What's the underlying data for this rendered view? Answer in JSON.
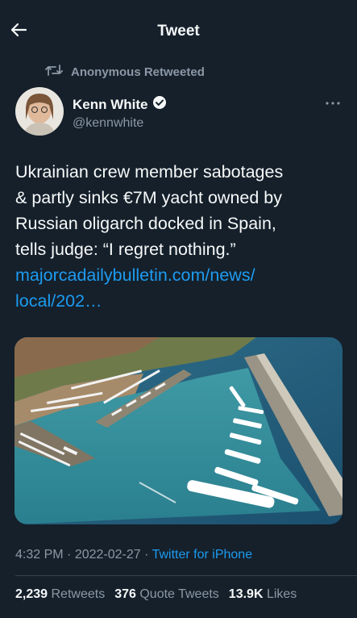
{
  "header": {
    "title": "Tweet"
  },
  "retweet": {
    "label": "Anonymous Retweeted"
  },
  "author": {
    "name": "Kenn White",
    "handle": "@kennwhite"
  },
  "tweet": {
    "lines": [
      "Ukrainian crew member sabotages",
      "& partly sinks €7M yacht owned by",
      "Russian oligarch docked in Spain,",
      "tells judge: “I regret nothing.”"
    ],
    "link_line1": "majorcadailybulletin.com/news/",
    "link_line2": "local/202…"
  },
  "meta": {
    "time": "4:32 PM",
    "sep1": " · ",
    "date": "2022-02-27",
    "sep2": " · ",
    "source": "Twitter for iPhone"
  },
  "stats": {
    "retweets_count": "2,239",
    "retweets_label": "Retweets",
    "quotes_count": "376",
    "quotes_label": "Quote Tweets",
    "likes_count": "13.9K",
    "likes_label": "Likes"
  },
  "icons": {
    "back": "arrow-left-icon",
    "retweet": "retweet-icon",
    "verified": "verified-badge-icon",
    "more": "more-icon"
  },
  "colors": {
    "background": "#15202b",
    "accent": "#1d9bf0",
    "secondary_text": "#8b98a5"
  }
}
